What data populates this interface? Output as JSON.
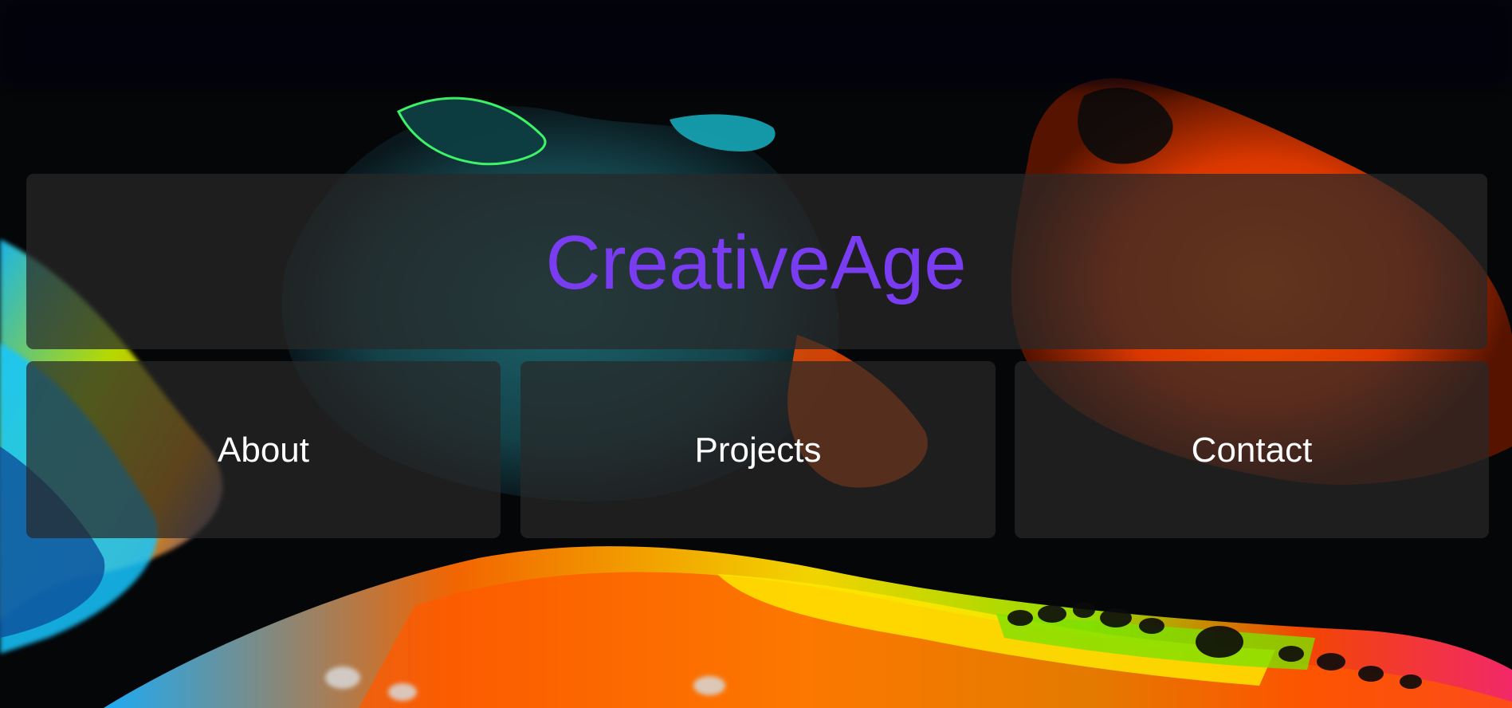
{
  "site": {
    "title": "CreativeAge"
  },
  "nav": {
    "items": [
      {
        "label": "About"
      },
      {
        "label": "Projects"
      },
      {
        "label": "Contact"
      }
    ]
  },
  "colors": {
    "title": "#7a3cf0",
    "nav_text": "#ffffff",
    "panel_bg": "rgba(40,40,40,0.72)",
    "page_bg": "#050608"
  },
  "background": {
    "icon": "abstract-fluid-paint-art"
  }
}
